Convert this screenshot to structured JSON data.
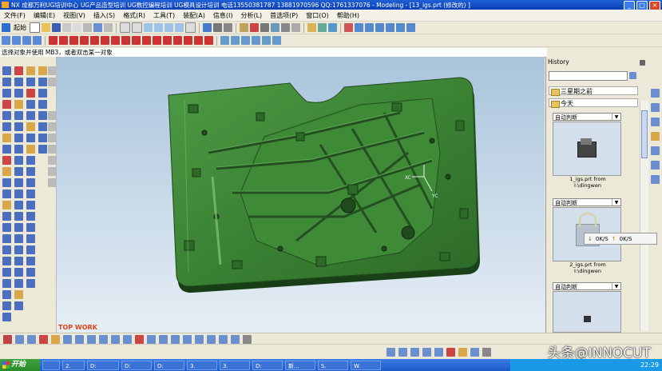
{
  "window": {
    "title": "NX 成都万利UG培训中心   UG产品造型培训   UG数控编程培训   UG模具设计培训   电话13550381787  13881970596  QQ:1761337076 - Modeling - [13_igs.prt  (修改的) ]",
    "minimize": "_",
    "maximize": "□",
    "close": "×"
  },
  "menu": [
    "文件(F)",
    "编辑(E)",
    "视图(V)",
    "插入(S)",
    "格式(R)",
    "工具(T)",
    "装配(A)",
    "信息(I)",
    "分析(L)",
    "首选项(P)",
    "窗口(O)",
    "帮助(H)"
  ],
  "toolbar": {
    "start_label": "起始",
    "colors": [
      "#3a7bd5",
      "#d9a64a",
      "#6bbb4e",
      "#c0392b",
      "#8e44ad",
      "#2c9faf",
      "#777777"
    ]
  },
  "status_prompt": "选择对象并使用 MB3，或者双击某一对象",
  "viewport": {
    "view_label": "TOP WORK",
    "axis_x": "XC",
    "axis_y": "YC",
    "background": "#c3d6e6",
    "part_color": "#3f8a3a"
  },
  "history": {
    "title": "History",
    "groups": [
      "三星期之前",
      "今天"
    ],
    "entries": [
      {
        "select": "自动判断",
        "caption_line1": "1_igs.prt from",
        "caption_line2": "I:\\dingwen"
      },
      {
        "select": "自动判断",
        "caption_line1": "2_igs.prt from",
        "caption_line2": "I:\\dingwen"
      },
      {
        "select": "自动判断",
        "caption_line1": "",
        "caption_line2": ""
      }
    ]
  },
  "popup": {
    "label1": "0K/S",
    "label2": "0K/S"
  },
  "taskbar": {
    "start": "开始",
    "tasks": [
      "",
      "2.",
      "D:",
      "D:",
      "D:",
      "3.",
      "3.",
      "D:",
      "新...",
      "S.",
      "W."
    ],
    "time": "22:29"
  },
  "watermark": "头条@INNOCUT"
}
